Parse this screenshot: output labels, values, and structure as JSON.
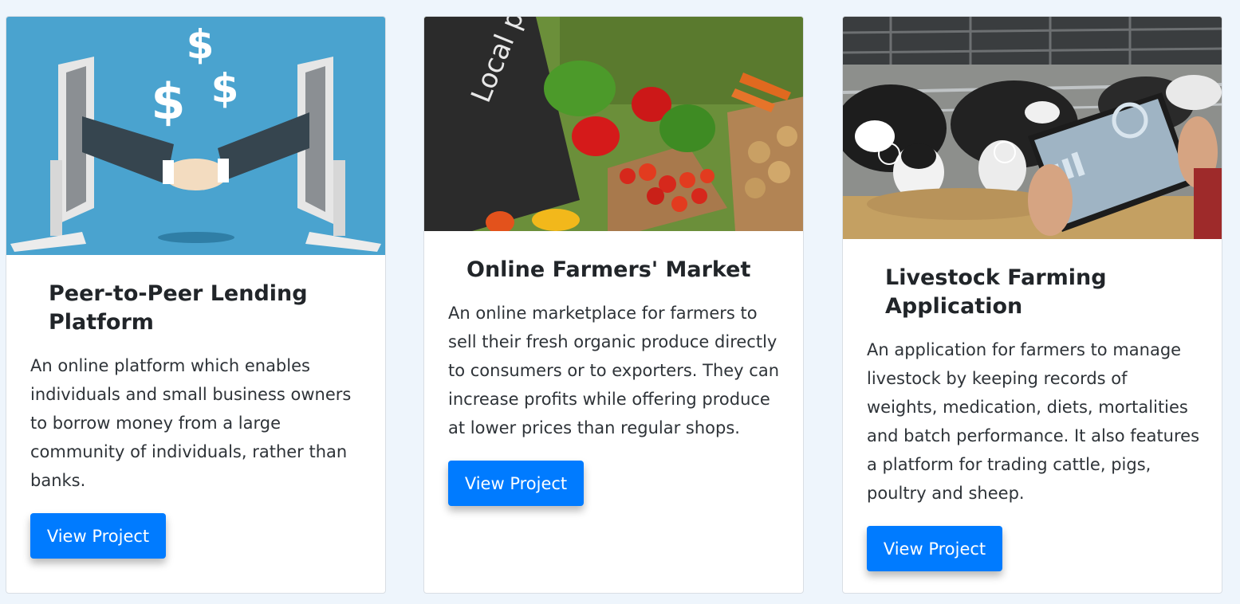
{
  "projects": [
    {
      "title": "Peer-to-Peer Lending Platform",
      "description": "An online platform which enables individuals and small business owners to borrow money from a large community of individuals, rather than banks.",
      "button_label": "View Project",
      "image_icon": "handshake-laptops-image"
    },
    {
      "title": "Online Farmers' Market",
      "description": "An online marketplace for farmers to sell their fresh organic produce directly to consumers or to exporters. They can increase profits while offering produce at lower prices than regular shops.",
      "button_label": "View Project",
      "image_icon": "local-produce-image",
      "image_text": "Local products"
    },
    {
      "title": "Livestock Farming Application",
      "description": "An application for farmers to manage livestock by keeping records of weights, medication, diets, mortalities and batch performance. It also features a platform for trading cattle, pigs, poultry and sheep.",
      "button_label": "View Project",
      "image_icon": "cattle-tablet-image"
    }
  ],
  "colors": {
    "page_background": "#eef5fc",
    "button_primary": "#007bff",
    "image1_background": "#4aa3cf"
  }
}
